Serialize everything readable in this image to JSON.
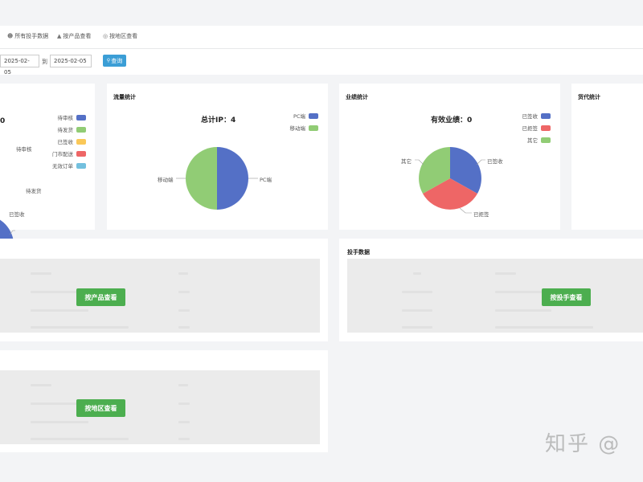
{
  "nav": {
    "tabs": [
      {
        "label": "所有投手数据",
        "icon": "users-icon"
      },
      {
        "label": "按产品查看",
        "icon": "boxes-icon"
      },
      {
        "label": "按地区查看",
        "icon": "globe-icon"
      }
    ]
  },
  "filter": {
    "start_date": "2025-02-05",
    "to_label": "到",
    "end_date": "2025-02-05",
    "query_label": "查询"
  },
  "cards": {
    "order_stats": {
      "total_value": "0",
      "legend": [
        "待审核",
        "待发货",
        "已签收",
        "门市配送",
        "无效订单"
      ],
      "pie_labels": [
        "待审核",
        "待发货",
        "已签收"
      ]
    },
    "traffic_stats": {
      "title": "流量统计",
      "total": "总计IP：4",
      "legend": [
        "PC端",
        "移动端"
      ],
      "pie_labels": [
        "移动端",
        "PC端"
      ]
    },
    "performance_stats": {
      "title": "业绩统计",
      "total": "有效业绩：0",
      "legend": [
        "已签收",
        "已拒签",
        "其它"
      ],
      "pie_labels": [
        "其它",
        "已签收",
        "已拒签"
      ]
    },
    "agent_stats": {
      "title": "货代统计"
    },
    "product_table": {
      "button_label": "按产品查看"
    },
    "pitcher_data": {
      "title": "投手数据",
      "button_label": "按投手查看"
    },
    "region_table": {
      "button_label": "按地区查看"
    }
  },
  "watermark": "知乎 @",
  "colors": {
    "blue": "#5470c6",
    "green": "#91cc75",
    "yellow": "#fac858",
    "red": "#ee6666",
    "cyan": "#73c0de",
    "button_green": "#4cae4f",
    "button_blue": "#3b9ed6"
  }
}
